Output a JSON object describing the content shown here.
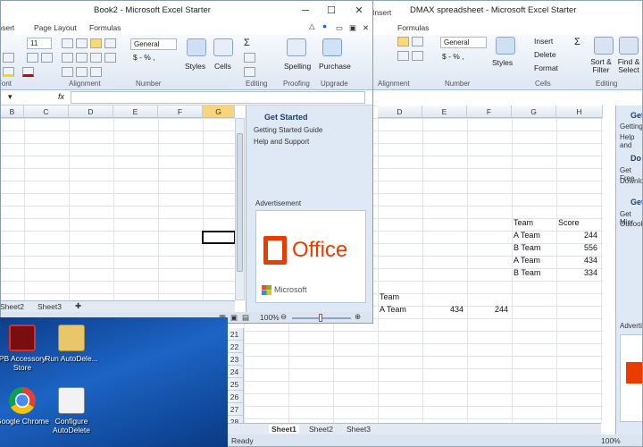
{
  "desktop": {
    "icons": [
      {
        "label": "PB Accessory Store",
        "name": "pb-accessory-store-icon"
      },
      {
        "label": "Run AutoDele...",
        "name": "run-autodelete-icon"
      },
      {
        "label": "Google Chrome",
        "name": "google-chrome-icon"
      },
      {
        "label": "Configure AutoDelete",
        "name": "configure-autodelete-icon"
      }
    ]
  },
  "right_window": {
    "title": "DMAX spreadsheet - Microsoft Excel Starter",
    "tabs": [
      "Insert",
      "Formulas"
    ],
    "ribbon": {
      "number_format": "General",
      "number_symbols": "$ - % ,",
      "styles_label": "Styles",
      "insert_label": "Insert",
      "delete_label": "Delete",
      "format_label": "Format",
      "sum_symbol": "Σ",
      "sort_label": "Sort & Filter",
      "find_label": "Find & Select",
      "groups": [
        "Alignment",
        "Number",
        "Cells",
        "Editing"
      ]
    },
    "columns": [
      "D",
      "E",
      "F",
      "G",
      "H"
    ],
    "table": {
      "header": [
        "Team",
        "Score"
      ],
      "rows": [
        [
          "A Team",
          "244"
        ],
        [
          "B Team",
          "556"
        ],
        [
          "A Team",
          "434"
        ],
        [
          "B Team",
          "334"
        ]
      ]
    },
    "extra": {
      "team_header": "Team",
      "row_team": "A Team",
      "v1": "434",
      "v2": "244"
    },
    "rows_visible": [
      "21",
      "22",
      "23",
      "24",
      "25",
      "26",
      "27",
      "28"
    ],
    "sheets": [
      "Sheet1",
      "Sheet2",
      "Sheet3"
    ],
    "status": "Ready",
    "zoom": "100%",
    "pane": {
      "items": [
        "Get",
        "Getting",
        "Help and",
        "Do",
        "Get Free",
        "Downloa",
        "Get",
        "Get Micr",
        "Outlook"
      ],
      "advert": "Advertise"
    }
  },
  "left_window": {
    "title": "Book2 - Microsoft Excel Starter",
    "tabs": [
      "Insert",
      "Page Layout",
      "Formulas"
    ],
    "font_size": "11",
    "number_format": "General",
    "number_symbols": "$ - % ,",
    "groups": [
      "Font",
      "Alignment",
      "Number",
      "Editing",
      "Proofing",
      "Upgrade"
    ],
    "buttons": {
      "styles": "Styles",
      "cells": "Cells",
      "spelling": "Spelling",
      "purchase": "Purchase",
      "sum": "Σ"
    },
    "name_box_arrow": "▾",
    "fx": "fx",
    "columns": [
      "B",
      "C",
      "D",
      "E",
      "F",
      "G"
    ],
    "sheets": [
      "Sheet2",
      "Sheet3"
    ],
    "zoom": "100%",
    "pane": {
      "title": "Get Started",
      "links": [
        "Getting Started Guide",
        "Help and Support"
      ],
      "advert_label": "Advertisement",
      "office_text": "Office",
      "microsoft_text": "Microsoft"
    }
  },
  "colors": {
    "accent": "#f0c24b",
    "office_orange": "#eb3c00",
    "pane_bg": "#dfe9f6"
  }
}
